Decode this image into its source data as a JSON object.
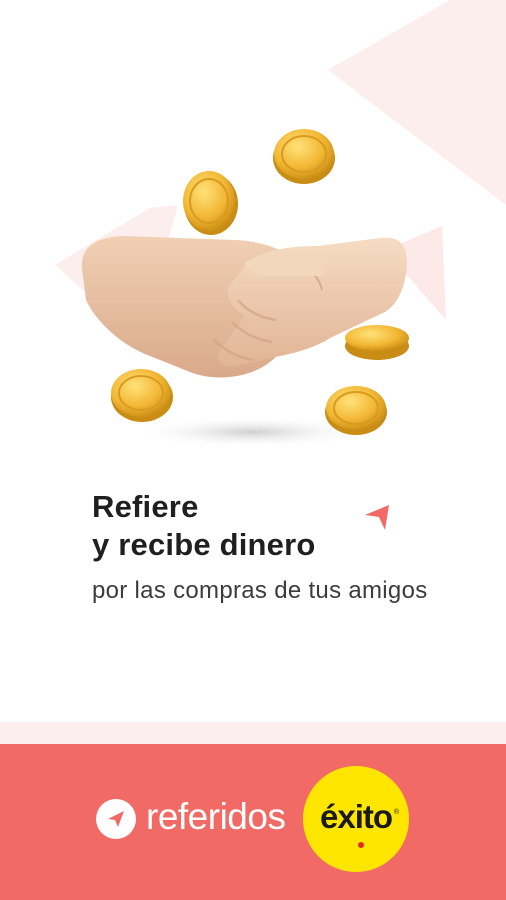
{
  "hero": {
    "headline_line1": "Refiere",
    "headline_line2": "y recibe dinero",
    "subtext": "por las compras de tus amigos"
  },
  "footer": {
    "brand_label": "referidos",
    "logo_text": "éxito",
    "logo_mark": "®"
  },
  "icons": {
    "hero": "handshake-with-coins",
    "accent": "paper-plane-arrow",
    "brand": "paper-plane-icon"
  },
  "colors": {
    "footer_bg": "#f26a65",
    "accent": "#f26a65",
    "background_shapes": "#fdeeee",
    "logo_badge": "#ffe600",
    "headline": "#1f1f1f"
  }
}
